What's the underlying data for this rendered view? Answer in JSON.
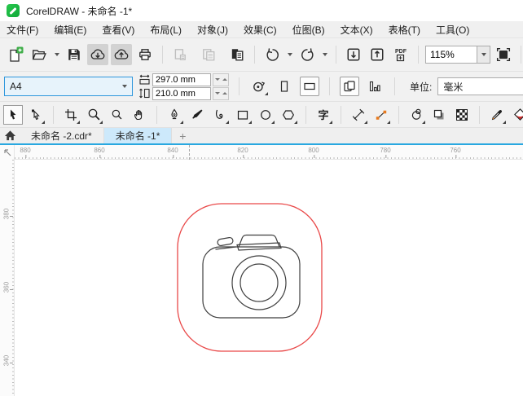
{
  "window": {
    "title": "CorelDRAW - 未命名 -1*"
  },
  "menu": {
    "items": [
      "文件(F)",
      "编辑(E)",
      "查看(V)",
      "布局(L)",
      "对象(J)",
      "效果(C)",
      "位图(B)",
      "文本(X)",
      "表格(T)",
      "工具(O)"
    ]
  },
  "toolbar": {
    "zoom_level": "115%",
    "pdf_label": "PDF"
  },
  "property_bar": {
    "paper_size": "A4",
    "page_width": "297.0 mm",
    "page_height": "210.0 mm",
    "units_label": "单位:",
    "units_value": "毫米"
  },
  "toolbox": {
    "text_tool_glyph": "字"
  },
  "tabbar": {
    "tabs": [
      {
        "label": "未命名 -2.cdr*",
        "active": false
      },
      {
        "label": "未命名 -1*",
        "active": true
      }
    ],
    "new_tab_label": "+"
  },
  "rulers": {
    "horizontal": [
      "880",
      "860",
      "840",
      "820",
      "800",
      "780",
      "760"
    ],
    "vertical": [
      "380",
      "360",
      "340"
    ]
  },
  "colors": {
    "accent_blue": "#2f97dc",
    "tab_active_bg": "#cde9fb",
    "tabbar_line": "#29a8e0",
    "artboard_outline_red": "#e94848",
    "drawing_stroke": "#3f3f3f",
    "pressed_button_bg": "#d2d2d2",
    "connector_orange": "#e87a1e",
    "fill_tool_red": "#d42a2a",
    "new_doc_green": "#3fae49"
  }
}
